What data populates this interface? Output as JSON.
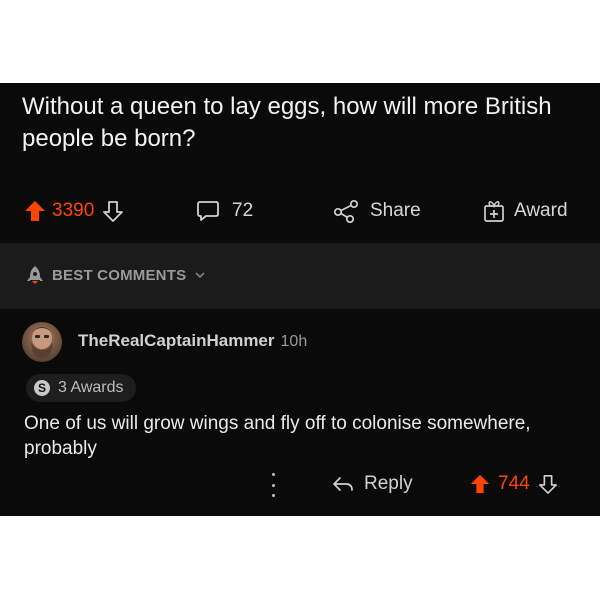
{
  "post": {
    "title": "Without a queen to lay eggs, how will more British people be born?",
    "score": "3390",
    "comment_count": "72",
    "share_label": "Share",
    "award_label": "Award"
  },
  "sort": {
    "label": "BEST COMMENTS"
  },
  "comment": {
    "author": "TheRealCaptainHammer",
    "age": "10h",
    "awards": "3 Awards",
    "award_coin": "S",
    "body": "One of us will grow wings and fly off to colonise somewhere, probably",
    "reply_label": "Reply",
    "score": "744"
  },
  "colors": {
    "background": "#0a0a0a",
    "upvote": "#ff4500",
    "sort_bar": "#1b1b1b",
    "text": "#e6e6e6",
    "muted": "#9a9a9a"
  },
  "icons": [
    "upvote-icon",
    "downvote-icon",
    "comment-bubble-icon",
    "share-icon",
    "award-icon",
    "rocket-icon",
    "chevron-down-icon",
    "more-dots-icon",
    "reply-icon"
  ]
}
